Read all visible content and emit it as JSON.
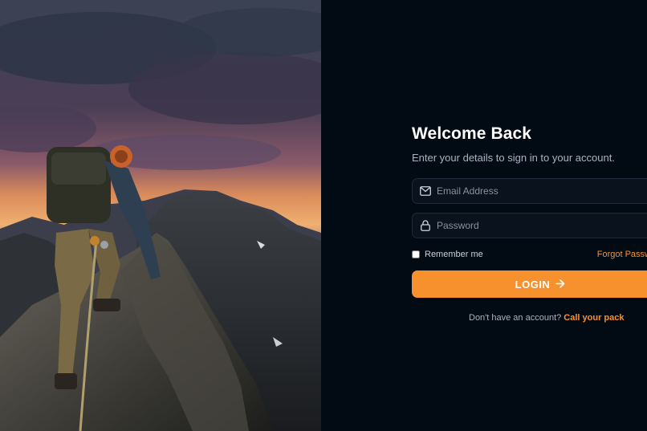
{
  "hero": {
    "image_description": "",
    "alt": ""
  },
  "login": {
    "title": "Welcome Back",
    "subtitle": "Enter your details to sign in to your account.",
    "email": {
      "placeholder": "Email Address",
      "value": ""
    },
    "password": {
      "placeholder": "Password",
      "value": ""
    },
    "remember_label": "Remember me",
    "remember_checked": false,
    "forgot_label": "Forgot Password?",
    "button_label": "LOGIN",
    "signup_prompt": "Don't have an account?",
    "signup_link": "Call your pack"
  },
  "colors": {
    "accent": "#f7912d",
    "background": "#020a14",
    "field_bg": "#09121d",
    "field_border": "#1f2a38"
  },
  "icons": {
    "email": "mail-icon",
    "password": "lock-icon",
    "button": "arrow-right-icon"
  }
}
